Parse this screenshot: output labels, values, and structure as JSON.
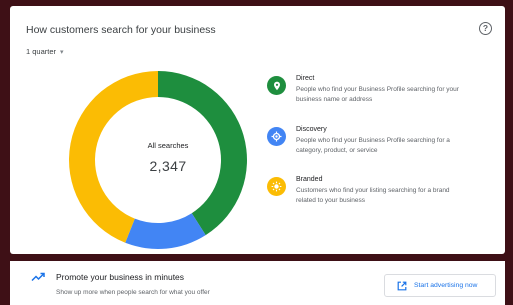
{
  "card": {
    "title": "How customers search for your business",
    "help_symbol": "?",
    "period_selected": "1 quarter",
    "caret_symbol": "▾"
  },
  "chart_data": {
    "type": "pie",
    "center_label": "All searches",
    "center_value": "2,347",
    "slices": [
      {
        "name": "Direct",
        "fraction": 0.41,
        "color": "#1e8e3e"
      },
      {
        "name": "Discovery",
        "fraction": 0.15,
        "color": "#4285f4"
      },
      {
        "name": "Branded",
        "fraction": 0.44,
        "color": "#fbbc04"
      }
    ]
  },
  "legend": [
    {
      "title": "Direct",
      "description": "People who find your Business Profile searching for your business name or address",
      "color": "#1e8e3e",
      "icon": "location-pin-icon"
    },
    {
      "title": "Discovery",
      "description": "People who find your Business Profile searching for a category, product, or service",
      "color": "#4285f4",
      "icon": "crosshair-icon"
    },
    {
      "title": "Branded",
      "description": "Customers who find your listing searching for a brand related to your business",
      "color": "#fbbc04",
      "icon": "sun-icon"
    }
  ],
  "promo": {
    "title": "Promote your business in minutes",
    "subtitle": "Show up more when people search for what you offer",
    "cta_label": "Start advertising now",
    "accent": "#1a73e8"
  }
}
